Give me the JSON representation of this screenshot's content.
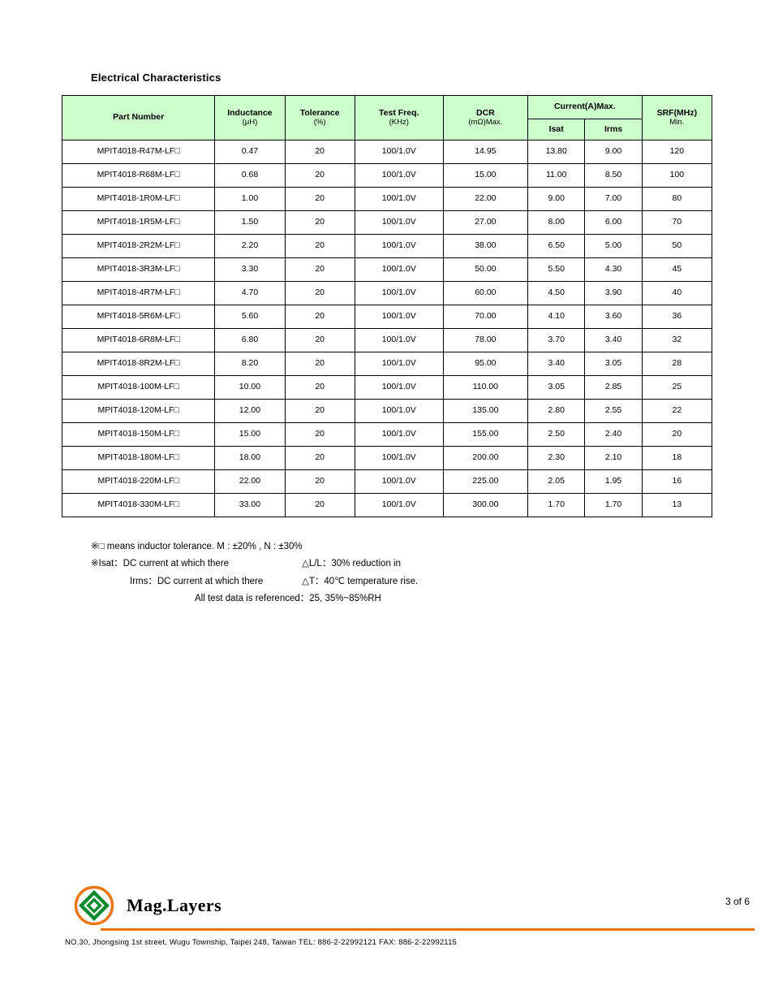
{
  "title": "Electrical Characteristics",
  "columns": {
    "part_number": "Part Number",
    "inductance": "Inductance",
    "inductance_unit": "(μH)",
    "tolerance": "Tolerance",
    "tolerance_unit": "(%)",
    "test_freq": "Test Freq.",
    "test_freq_unit": "(KHz)",
    "dcr": "DCR",
    "dcr_unit": "(mΩ)Max.",
    "current_group": "Current(A)Max.",
    "isat": "Isat",
    "irms": "Irms",
    "srf": "SRF(MHz)",
    "srf_sub": "Min."
  },
  "rows": [
    {
      "pn": "MPIT4018-R47M-LF□",
      "ind": "0.47",
      "tol": "20",
      "freq": "100/1.0V",
      "dcr": "14.95",
      "isat": "13.80",
      "irms": "9.00",
      "srf": "120"
    },
    {
      "pn": "MPIT4018-R68M-LF□",
      "ind": "0.68",
      "tol": "20",
      "freq": "100/1.0V",
      "dcr": "15.00",
      "isat": "11.00",
      "irms": "8.50",
      "srf": "100"
    },
    {
      "pn": "MPIT4018-1R0M-LF□",
      "ind": "1.00",
      "tol": "20",
      "freq": "100/1.0V",
      "dcr": "22.00",
      "isat": "9.00",
      "irms": "7.00",
      "srf": "80"
    },
    {
      "pn": "MPIT4018-1R5M-LF□",
      "ind": "1.50",
      "tol": "20",
      "freq": "100/1.0V",
      "dcr": "27.00",
      "isat": "8.00",
      "irms": "6.00",
      "srf": "70"
    },
    {
      "pn": "MPIT4018-2R2M-LF□",
      "ind": "2.20",
      "tol": "20",
      "freq": "100/1.0V",
      "dcr": "38.00",
      "isat": "6.50",
      "irms": "5.00",
      "srf": "50"
    },
    {
      "pn": "MPIT4018-3R3M-LF□",
      "ind": "3.30",
      "tol": "20",
      "freq": "100/1.0V",
      "dcr": "50.00",
      "isat": "5.50",
      "irms": "4.30",
      "srf": "45"
    },
    {
      "pn": "MPIT4018-4R7M-LF□",
      "ind": "4.70",
      "tol": "20",
      "freq": "100/1.0V",
      "dcr": "60.00",
      "isat": "4.50",
      "irms": "3.90",
      "srf": "40"
    },
    {
      "pn": "MPIT4018-5R6M-LF□",
      "ind": "5.60",
      "tol": "20",
      "freq": "100/1.0V",
      "dcr": "70.00",
      "isat": "4.10",
      "irms": "3.60",
      "srf": "36"
    },
    {
      "pn": "MPIT4018-6R8M-LF□",
      "ind": "6.80",
      "tol": "20",
      "freq": "100/1.0V",
      "dcr": "78.00",
      "isat": "3.70",
      "irms": "3.40",
      "srf": "32"
    },
    {
      "pn": "MPIT4018-8R2M-LF□",
      "ind": "8.20",
      "tol": "20",
      "freq": "100/1.0V",
      "dcr": "95.00",
      "isat": "3.40",
      "irms": "3.05",
      "srf": "28"
    },
    {
      "pn": "MPIT4018-100M-LF□",
      "ind": "10.00",
      "tol": "20",
      "freq": "100/1.0V",
      "dcr": "110.00",
      "isat": "3.05",
      "irms": "2.85",
      "srf": "25"
    },
    {
      "pn": "MPIT4018-120M-LF□",
      "ind": "12.00",
      "tol": "20",
      "freq": "100/1.0V",
      "dcr": "135.00",
      "isat": "2.80",
      "irms": "2.55",
      "srf": "22"
    },
    {
      "pn": "MPIT4018-150M-LF□",
      "ind": "15.00",
      "tol": "20",
      "freq": "100/1.0V",
      "dcr": "155.00",
      "isat": "2.50",
      "irms": "2.40",
      "srf": "20"
    },
    {
      "pn": "MPIT4018-180M-LF□",
      "ind": "18.00",
      "tol": "20",
      "freq": "100/1.0V",
      "dcr": "200.00",
      "isat": "2.30",
      "irms": "2.10",
      "srf": "18"
    },
    {
      "pn": "MPIT4018-220M-LF□",
      "ind": "22.00",
      "tol": "20",
      "freq": "100/1.0V",
      "dcr": "225.00",
      "isat": "2.05",
      "irms": "1.95",
      "srf": "16"
    },
    {
      "pn": "MPIT4018-330M-LF□",
      "ind": "33.00",
      "tol": "20",
      "freq": "100/1.0V",
      "dcr": "300.00",
      "isat": "1.70",
      "irms": "1.70",
      "srf": "13"
    }
  ],
  "notes": {
    "n1a": "※□ means inductor tolerance. M : ±20% , N : ±30%",
    "n2a": "※Isat：DC current at which there",
    "n2b": "△L/L：30% reduction in",
    "n3a": "Irms：DC current at which there",
    "n3b": "△T：40℃ temperature rise.",
    "n4": "All test data is referenced：25, 35%~85%RH"
  },
  "footer": {
    "company": "Mag.Layers",
    "page": "3 of 6",
    "address": "NO.30, Jhongsing 1st street, Wugu Township, Taipei 248, Taiwan       TEL: 886-2-22992121      FAX: 886-2-22992115"
  }
}
